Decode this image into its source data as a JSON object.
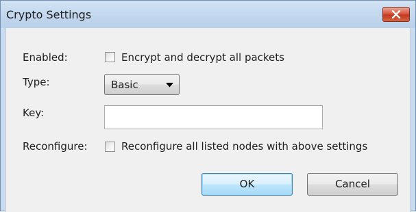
{
  "window": {
    "title": "Crypto Settings"
  },
  "form": {
    "enabled_label": "Enabled:",
    "encrypt_checkbox_label": "Encrypt and decrypt all packets",
    "encrypt_checked": false,
    "type_label": "Type:",
    "type_selected": "Basic",
    "key_label": "Key:",
    "key_value": "",
    "reconfigure_label": "Reconfigure:",
    "reconfigure_checkbox_label": "Reconfigure all listed nodes with above settings",
    "reconfigure_checked": false
  },
  "buttons": {
    "ok_label": "OK",
    "cancel_label": "Cancel"
  },
  "icons": {
    "close": "close-icon",
    "dropdown": "chevron-down-icon"
  },
  "colors": {
    "titlebar": "#c4d8ee",
    "close_button": "#d9563f",
    "client_background": "#f0f0f0",
    "default_button_border": "#3c7fb1"
  }
}
